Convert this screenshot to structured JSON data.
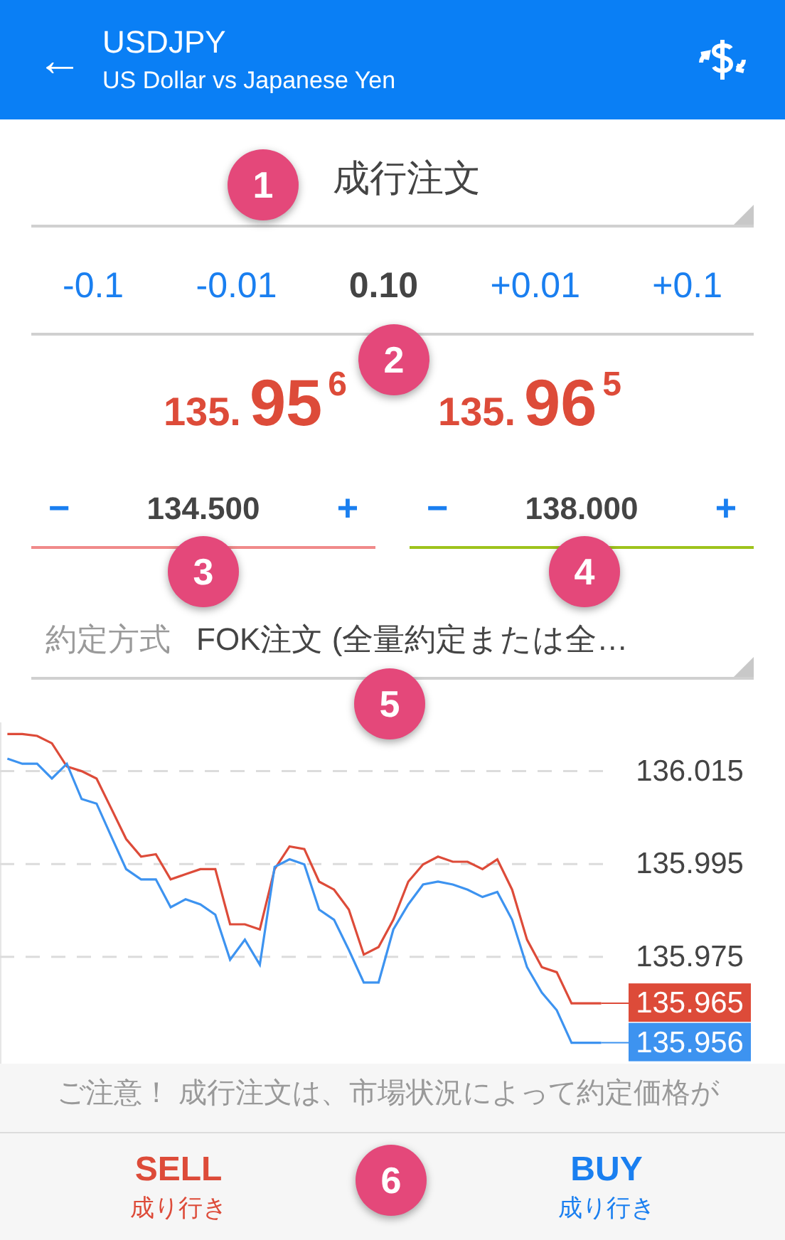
{
  "header": {
    "back": "←",
    "symbol": "USDJPY",
    "description": "US Dollar vs Japanese Yen"
  },
  "order_type": {
    "value": "成行注文"
  },
  "volume": [
    {
      "kind": "step",
      "label": "-0.1"
    },
    {
      "kind": "step",
      "label": "-0.01"
    },
    {
      "kind": "value",
      "label": "0.10"
    },
    {
      "kind": "step",
      "label": "+0.01"
    },
    {
      "kind": "step",
      "label": "+0.1"
    }
  ],
  "prices": [
    {
      "prefix": "135.",
      "big": "95",
      "sup": "6"
    },
    {
      "prefix": "135.",
      "big": "96",
      "sup": "5"
    }
  ],
  "levels": [
    {
      "kind": "stop_loss",
      "minus": "−",
      "value": "134.500",
      "plus": "+"
    },
    {
      "kind": "take_profit",
      "minus": "−",
      "value": "138.000",
      "plus": "+"
    }
  ],
  "fill_policy": {
    "label": "約定方式",
    "value": "FOK注文 (全量約定または全…"
  },
  "chart": {
    "chart_data": {
      "type": "line",
      "categories": [
        null,
        null,
        null,
        null,
        null,
        null,
        null,
        null,
        null,
        null,
        null,
        null,
        null,
        null,
        null,
        null,
        null,
        null,
        null,
        null,
        null,
        null,
        null,
        null,
        null,
        null,
        null,
        null,
        null,
        null,
        null,
        null,
        null,
        null,
        null,
        null,
        null,
        null,
        null,
        null,
        null
      ],
      "grid": true,
      "ylim": [
        135.952,
        136.0255
      ],
      "yticks": [
        {
          "value": 136.015,
          "label": "136.015"
        },
        {
          "value": 135.995,
          "label": "135.995"
        },
        {
          "value": 135.975,
          "label": "135.975"
        }
      ],
      "series": [
        {
          "color": "#dd4b39",
          "values": [
            136.023,
            136.023,
            136.0226,
            136.021,
            136.016,
            136.015,
            136.0134,
            136.0069,
            136.0004,
            135.9966,
            135.9971,
            135.9917,
            135.9928,
            135.9939,
            135.9939,
            135.982,
            135.982,
            135.9809,
            135.9939,
            135.9988,
            135.9982,
            135.9912,
            135.9895,
            135.9852,
            135.9755,
            135.9771,
            135.983,
            135.9912,
            135.9949,
            135.9966,
            135.9955,
            135.9955,
            135.9939,
            135.996,
            135.9895,
            135.9787,
            135.9728,
            135.9717,
            135.965,
            135.965,
            135.965
          ]
        },
        {
          "color": "#3d93f0",
          "values": [
            136.0177,
            136.0166,
            136.0166,
            136.0134,
            136.0166,
            136.009,
            136.008,
            136.0009,
            135.9939,
            135.9917,
            135.9917,
            135.9857,
            135.9874,
            135.9863,
            135.9841,
            135.9744,
            135.9787,
            135.9733,
            135.9944,
            135.996,
            135.9949,
            135.9852,
            135.983,
            135.9765,
            135.9695,
            135.9695,
            135.9809,
            135.9863,
            135.9906,
            135.9912,
            135.9906,
            135.9895,
            135.9879,
            135.989,
            135.983,
            135.9728,
            135.9673,
            135.9635,
            135.9565,
            135.9565,
            135.9565
          ]
        }
      ]
    },
    "price_tags": [
      {
        "label": "135.965",
        "color": "#dd4b39"
      },
      {
        "label": "135.956",
        "color": "#3d93f0"
      }
    ]
  },
  "notice": "ご注意！ 成行注文は、市場状況によって約定価格が",
  "actions": [
    {
      "kind": "sell",
      "label": "SELL",
      "sub": "成り行き"
    },
    {
      "kind": "buy",
      "label": "BUY",
      "sub": "成り行き"
    }
  ],
  "markers": [
    "1",
    "2",
    "3",
    "4",
    "5",
    "6"
  ]
}
